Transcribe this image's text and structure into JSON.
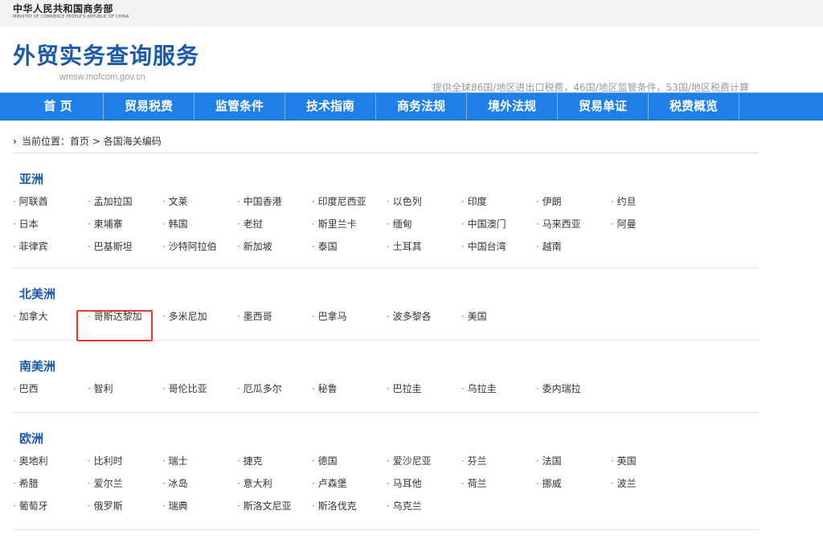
{
  "ministry": {
    "cn": "中华人民共和国商务部",
    "en": "MINISTRY OF COMMERCE PEOPLE'S REPUBLIC OF CHINA"
  },
  "site": {
    "title": "外贸实务查询服务",
    "url": "wmsw.mofcom.gov.cn",
    "tagline": "提供全球86国/地区进出口税费，46国/地区监管条件，53国/地区税费计算"
  },
  "nav": {
    "items": [
      {
        "label": "首 页"
      },
      {
        "label": "贸易税费"
      },
      {
        "label": "监管条件"
      },
      {
        "label": "技术指南"
      },
      {
        "label": "商务法规"
      },
      {
        "label": "境外法规"
      },
      {
        "label": "贸易单证"
      },
      {
        "label": "税费概览"
      }
    ]
  },
  "breadcrumb": {
    "prefix": "当前位置：",
    "home": "首页",
    "sep": ">",
    "current": "各国海关编码"
  },
  "regions": [
    {
      "name": "亚洲",
      "countries": [
        "阿联酋",
        "孟加拉国",
        "文莱",
        "中国香港",
        "印度尼西亚",
        "以色列",
        "印度",
        "伊朗",
        "约旦",
        "日本",
        "柬埔寨",
        "韩国",
        "老挝",
        "斯里兰卡",
        "缅甸",
        "中国澳门",
        "马来西亚",
        "阿曼",
        "菲律宾",
        "巴基斯坦",
        "沙特阿拉伯",
        "新加坡",
        "泰国",
        "土耳其",
        "中国台湾",
        "越南"
      ]
    },
    {
      "name": "北美洲",
      "countries": [
        "加拿大",
        "哥斯达黎加",
        "多米尼加",
        "墨西哥",
        "巴拿马",
        "波多黎各",
        "美国"
      ]
    },
    {
      "name": "南美洲",
      "countries": [
        "巴西",
        "智利",
        "哥伦比亚",
        "厄瓜多尔",
        "秘鲁",
        "巴拉圭",
        "乌拉圭",
        "委内瑞拉"
      ]
    },
    {
      "name": "欧洲",
      "countries": [
        "奥地利",
        "比利时",
        "瑞士",
        "捷克",
        "德国",
        "爱沙尼亚",
        "芬兰",
        "法国",
        "英国",
        "希腊",
        "爱尔兰",
        "冰岛",
        "意大利",
        "卢森堡",
        "马耳他",
        "荷兰",
        "挪威",
        "波兰",
        "葡萄牙",
        "俄罗斯",
        "瑞典",
        "斯洛文尼亚",
        "斯洛伐克",
        "乌克兰"
      ]
    }
  ],
  "highlight_color": "#e53a30",
  "accent_color": "#1e7fe6"
}
